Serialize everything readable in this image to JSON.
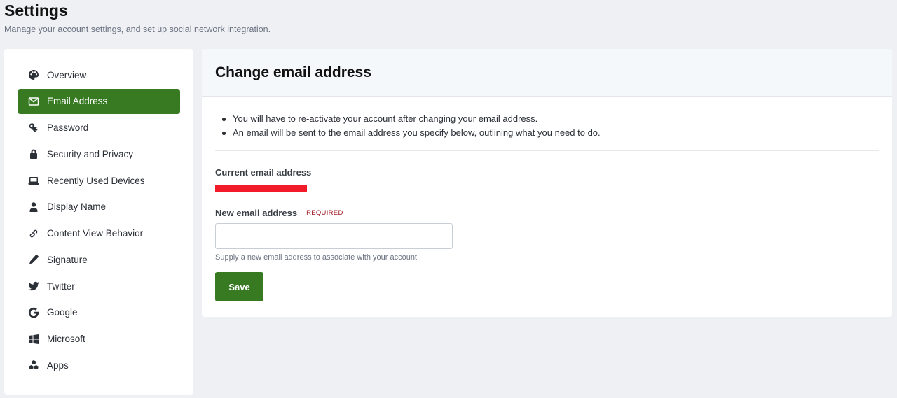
{
  "header": {
    "title": "Settings",
    "subtitle": "Manage your account settings, and set up social network integration."
  },
  "sidebar": {
    "items": [
      {
        "label": "Overview",
        "icon": "palette-icon"
      },
      {
        "label": "Email Address",
        "icon": "envelope-icon",
        "active": true
      },
      {
        "label": "Password",
        "icon": "key-icon"
      },
      {
        "label": "Security and Privacy",
        "icon": "lock-icon"
      },
      {
        "label": "Recently Used Devices",
        "icon": "laptop-icon"
      },
      {
        "label": "Display Name",
        "icon": "user-icon"
      },
      {
        "label": "Content View Behavior",
        "icon": "link-icon"
      },
      {
        "label": "Signature",
        "icon": "pencil-icon"
      },
      {
        "label": "Twitter",
        "icon": "twitter-icon"
      },
      {
        "label": "Google",
        "icon": "google-icon"
      },
      {
        "label": "Microsoft",
        "icon": "windows-icon"
      },
      {
        "label": "Apps",
        "icon": "cubes-icon"
      }
    ]
  },
  "main": {
    "title": "Change email address",
    "notes": [
      "You will have to re-activate your account after changing your email address.",
      "An email will be sent to the email address you specify below, outlining what you need to do."
    ],
    "current_email_label": "Current email address",
    "new_email_label": "New email address",
    "required_label": "REQUIRED",
    "new_email_value": "",
    "new_email_hint": "Supply a new email address to associate with your account",
    "save_label": "Save"
  },
  "colors": {
    "accent": "#377a22",
    "background": "#eef0f4",
    "required": "#a01820",
    "redaction": "#f21b2a"
  }
}
